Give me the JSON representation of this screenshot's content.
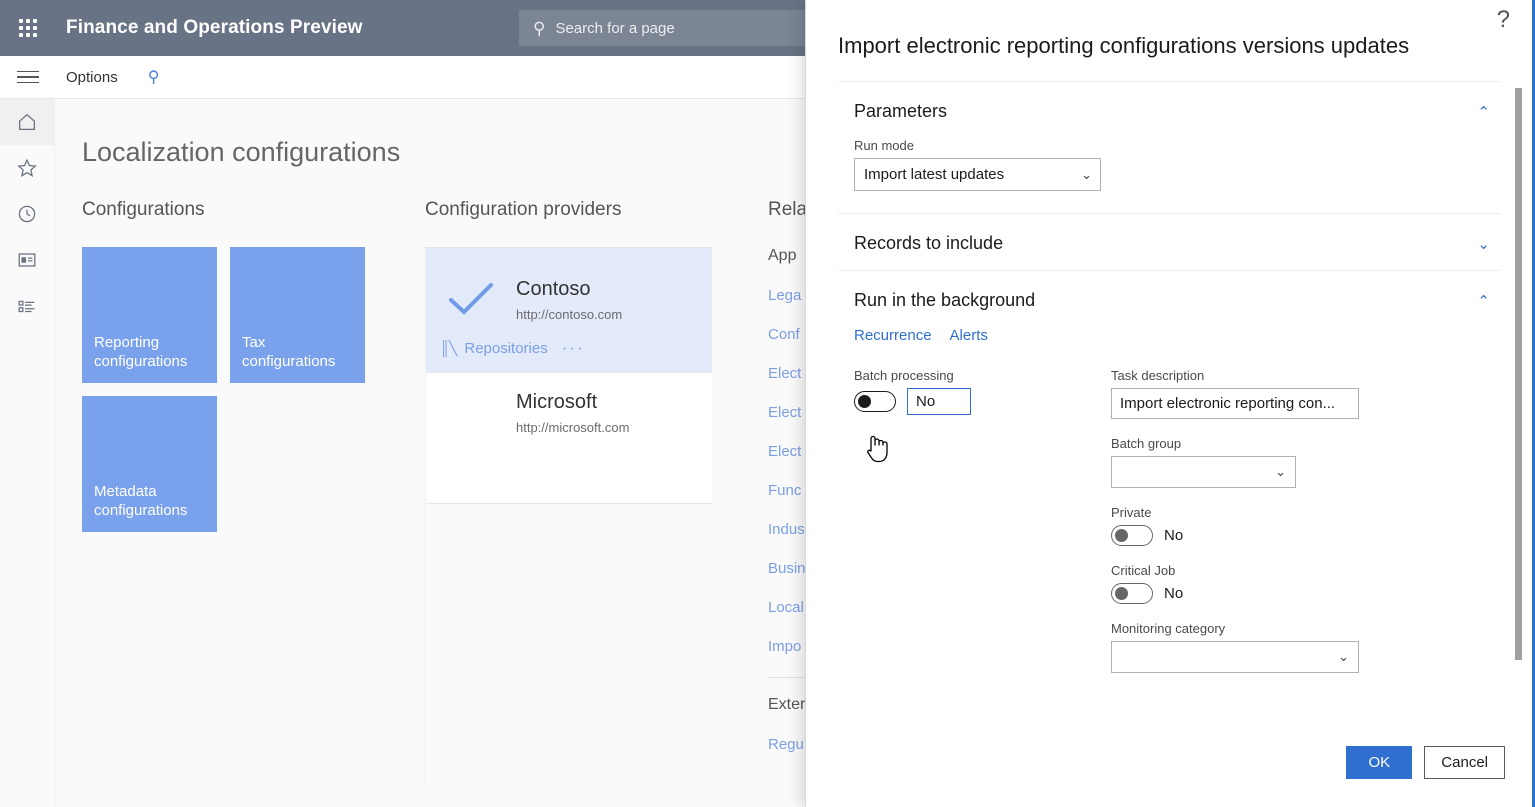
{
  "topbar": {
    "waffle_label": "App launcher",
    "app_title": "Finance and Operations Preview",
    "search_placeholder": "Search for a page",
    "search_value": ""
  },
  "commandbar": {
    "hamburger_label": "Show navigation pane",
    "options_label": "Options",
    "search_label": "Search"
  },
  "navrail": {
    "items": [
      {
        "name": "home",
        "glyph": "⌂",
        "label": "Home"
      },
      {
        "name": "favorites",
        "glyph": "☆",
        "label": "Favorites"
      },
      {
        "name": "recent",
        "glyph": "◴",
        "label": "Recent"
      },
      {
        "name": "workspaces",
        "glyph": "▤",
        "label": "Workspaces"
      },
      {
        "name": "modules",
        "glyph": "☰",
        "label": "Modules"
      }
    ]
  },
  "page": {
    "title": "Localization configurations",
    "configurations": {
      "heading": "Configurations",
      "tiles": [
        {
          "label": "Reporting configurations"
        },
        {
          "label": "Tax configurations"
        },
        {
          "label": "Metadata configurations"
        }
      ]
    },
    "providers": {
      "heading": "Configuration providers",
      "items": [
        {
          "name": "Contoso",
          "url": "http://contoso.com",
          "selected": true,
          "repositories_label": "Repositories",
          "overflow_label": "···"
        },
        {
          "name": "Microsoft",
          "url": "http://microsoft.com",
          "selected": false
        }
      ]
    },
    "related": {
      "heading": "Rela",
      "subheading": "App",
      "links": [
        "Lega",
        "Conf",
        "Elect",
        "Elect",
        "Elect",
        "Func",
        "Indus",
        "Busin",
        "Local",
        "Impo"
      ],
      "second_heading": "Exter",
      "second_links": [
        "Regu"
      ]
    }
  },
  "dialog": {
    "help_glyph": "?",
    "title": "Import electronic reporting configurations versions updates",
    "sections": {
      "parameters": {
        "title": "Parameters",
        "expanded": true,
        "chevron": "⌃",
        "run_mode": {
          "label": "Run mode",
          "value": "Import latest updates",
          "chevron": "⌄"
        }
      },
      "records": {
        "title": "Records to include",
        "expanded": false,
        "chevron": "⌄"
      },
      "background": {
        "title": "Run in the background",
        "expanded": true,
        "chevron": "⌃",
        "tabs": [
          {
            "label": "Recurrence"
          },
          {
            "label": "Alerts"
          }
        ],
        "batch_processing": {
          "label": "Batch processing",
          "value": "No",
          "on": false
        },
        "task_description": {
          "label": "Task description",
          "value": "Import electronic reporting con..."
        },
        "batch_group": {
          "label": "Batch group",
          "value": "",
          "chevron": "⌄"
        },
        "private": {
          "label": "Private",
          "value": "No",
          "on": false
        },
        "critical_job": {
          "label": "Critical Job",
          "value": "No",
          "on": false
        },
        "monitoring_category": {
          "label": "Monitoring category",
          "value": "",
          "chevron": "⌄"
        }
      }
    },
    "footer": {
      "ok_label": "OK",
      "cancel_label": "Cancel"
    }
  },
  "colors": {
    "topbar": "#687385",
    "tile": "#7aa2ec",
    "accent": "#2f6fd0",
    "link": "#7b9fe3",
    "selected_row": "#e3ebfb"
  }
}
